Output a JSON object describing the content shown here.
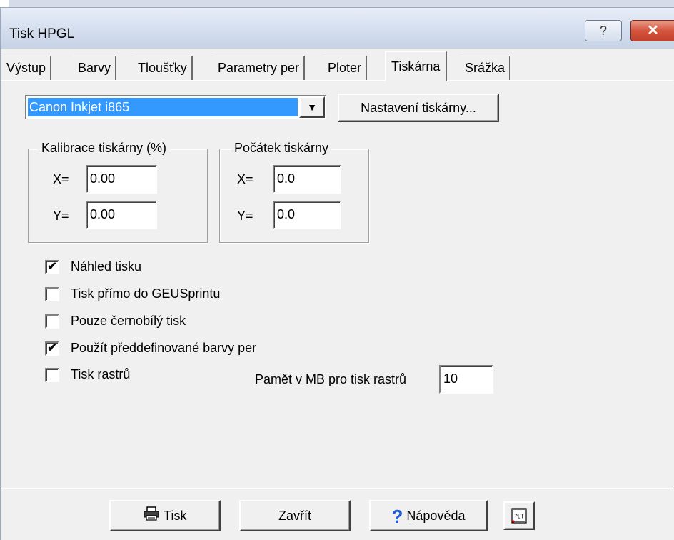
{
  "window": {
    "title": "Tisk HPGL",
    "help_label": "?",
    "close_label": "✕"
  },
  "tabs": [
    {
      "label": "Výstup"
    },
    {
      "label": "Barvy"
    },
    {
      "label": "Tloušťky"
    },
    {
      "label": "Parametry per"
    },
    {
      "label": "Ploter"
    },
    {
      "label": "Tiskárna",
      "active": true
    },
    {
      "label": "Srážka"
    }
  ],
  "printer": {
    "selected": "Canon Inkjet i865",
    "settings_button": "Nastavení tiskárny..."
  },
  "calibration": {
    "title": "Kalibrace tiskárny (%)",
    "x_label": "X=",
    "x_value": "0.00",
    "y_label": "Y=",
    "y_value": "0.00"
  },
  "origin": {
    "title": "Počátek tiskárny",
    "x_label": "X=",
    "x_value": "0.0",
    "y_label": "Y=",
    "y_value": "0.0"
  },
  "options": [
    {
      "label": "Náhled tisku",
      "checked": true
    },
    {
      "label": "Tisk přímo do GEUSprintu",
      "checked": false
    },
    {
      "label": "Pouze černobílý tisk",
      "checked": false
    },
    {
      "label": "Použít předdefinované barvy per",
      "checked": true
    },
    {
      "label": "Tisk rastrů",
      "checked": false
    }
  ],
  "raster_memory": {
    "label": "Pamět v MB pro tisk rastrů",
    "value": "10"
  },
  "buttons": {
    "print": "Tisk",
    "close": "Zavřít",
    "help_prefix": "N",
    "help_rest": "ápověda",
    "plt": "PLT"
  },
  "colors": {
    "selection": "#3399ff",
    "help_icon": "#1e5bd6",
    "close_button": "#c4402a"
  }
}
